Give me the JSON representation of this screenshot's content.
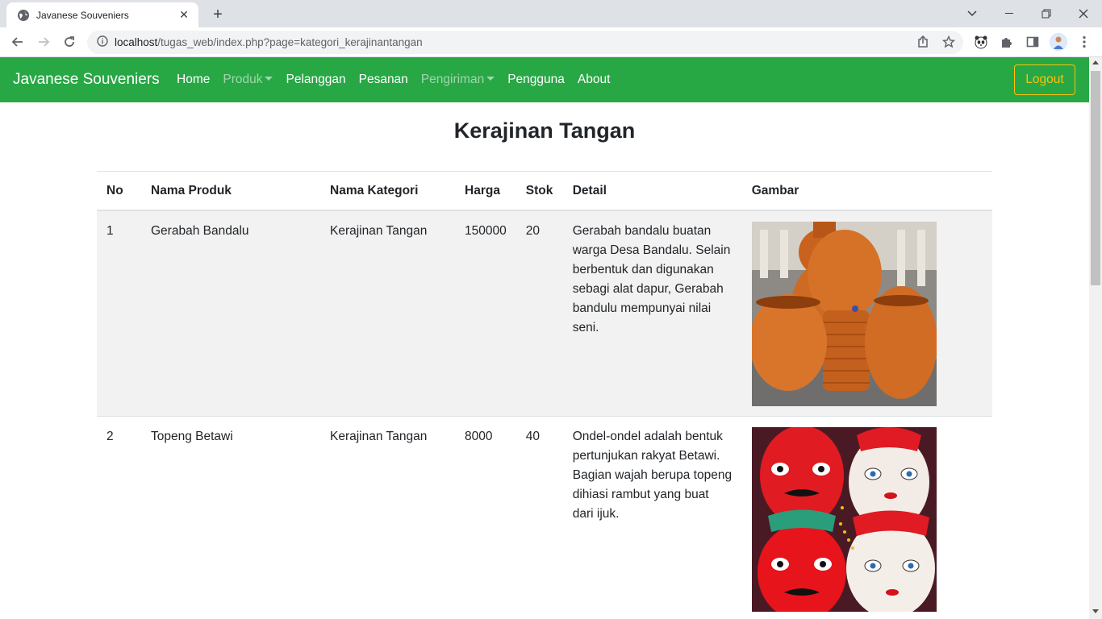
{
  "browser": {
    "tab_title": "Javanese Souveniers",
    "url_host": "localhost",
    "url_path": "/tugas_web/index.php?page=kategori_kerajinantangan"
  },
  "navbar": {
    "brand": "Javanese Souveniers",
    "links": [
      {
        "label": "Home",
        "active": true
      },
      {
        "label": "Produk",
        "dropdown": true,
        "active": false
      },
      {
        "label": "Pelanggan",
        "active": true
      },
      {
        "label": "Pesanan",
        "active": true
      },
      {
        "label": "Pengiriman",
        "dropdown": true,
        "active": false
      },
      {
        "label": "Pengguna",
        "active": true
      },
      {
        "label": "About",
        "active": true
      }
    ],
    "logout": "Logout"
  },
  "page": {
    "title": "Kerajinan Tangan",
    "columns": [
      "No",
      "Nama Produk",
      "Nama Kategori",
      "Harga",
      "Stok",
      "Detail",
      "Gambar"
    ],
    "rows": [
      {
        "no": "1",
        "nama_produk": "Gerabah Bandalu",
        "nama_kategori": "Kerajinan Tangan",
        "harga": "150000",
        "stok": "20",
        "detail": "Gerabah bandalu buatan warga Desa Bandalu. Selain berbentuk dan digunakan sebagi alat dapur, Gerabah bandulu mempunyai nilai seni.",
        "gambar": "pottery-image"
      },
      {
        "no": "2",
        "nama_produk": "Topeng Betawi",
        "nama_kategori": "Kerajinan Tangan",
        "harga": "8000",
        "stok": "40",
        "detail": "Ondel-ondel adalah bentuk pertunjukan rakyat Betawi. Bagian wajah berupa topeng dihiasi rambut yang buat dari ijuk.",
        "gambar": "mask-image"
      }
    ]
  },
  "colors": {
    "navbar": "#28a745",
    "logout": "#ffc107",
    "striped_row": "#f2f2f2"
  }
}
